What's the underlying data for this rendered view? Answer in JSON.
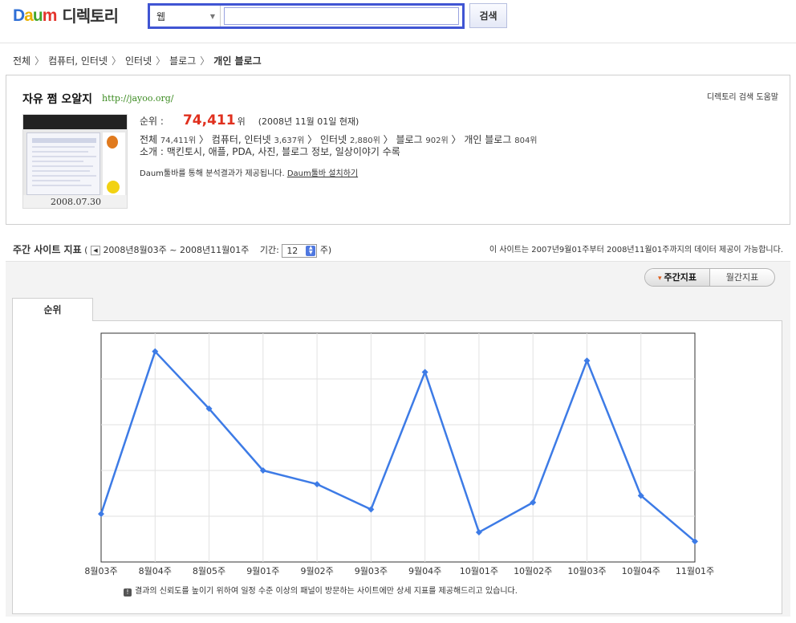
{
  "header": {
    "logo_letters": [
      {
        "ch": "D",
        "color": "#2f6fd6"
      },
      {
        "ch": "a",
        "color": "#e8b100"
      },
      {
        "ch": "u",
        "color": "#40a62d"
      },
      {
        "ch": "m",
        "color": "#e4342c"
      }
    ],
    "title": "디렉토리",
    "search_scope": "웹",
    "search_value": "",
    "search_button": "검색",
    "search_border_color": "#4055d3"
  },
  "breadcrumb": [
    {
      "label": "전체",
      "current": false
    },
    {
      "label": "컴퓨터, 인터넷",
      "current": false
    },
    {
      "label": "인터넷",
      "current": false
    },
    {
      "label": "블로그",
      "current": false
    },
    {
      "label": "개인 블로그",
      "current": true
    }
  ],
  "breadcrumb_separator": "〉",
  "site": {
    "name": "자유 쩜 오알지",
    "url": "http://jayoo.org/",
    "help_link": "디렉토리 검색 도움말",
    "thumbnail_date": "2008.07.30",
    "rank_label": "순위 :",
    "rank_value": "74,411",
    "rank_unit": "위",
    "rank_color": "#e0301e",
    "rank_date": "(2008년 11월 01일 현재)",
    "category_ranks": [
      {
        "name": "전체",
        "rank": "74,411위"
      },
      {
        "name": "컴퓨터, 인터넷",
        "rank": "3,637위"
      },
      {
        "name": "인터넷",
        "rank": "2,880위"
      },
      {
        "name": "블로그",
        "rank": "902위"
      },
      {
        "name": "개인 블로그",
        "rank": "804위"
      }
    ],
    "intro_label": "소개 :",
    "intro_text": "맥킨토시, 애플, PDA, 사진, 블로그 정보, 일상이야기 수록",
    "toolbar_note": "Daum툴바를 통해 분석결과가 제공됩니다.",
    "toolbar_link": "Daum툴바 설치하기"
  },
  "stats": {
    "title": "주간 사이트 지표",
    "range": "2008년8월03주 ~ 2008년11월01주",
    "period_label": "기간:",
    "period_value": "12",
    "period_unit": "주)",
    "availability_note": "이 사이트는 2007년9월01주부터 2008년11월01주까지의 데이터 제공이 가능합니다.",
    "toggle": [
      {
        "label": "주간지표",
        "active": true
      },
      {
        "label": "월간지표",
        "active": false
      }
    ],
    "tab_label": "순위",
    "notice": "결과의 신뢰도를 높이기 위하여 일정 수준 이상의 패널이 방문하는 사이트에만 상세 지표를 제공해드리고 있습니다."
  },
  "chart_data": {
    "type": "line",
    "title": "",
    "xlabel": "",
    "ylabel": "",
    "categories": [
      "8월03주",
      "8월04주",
      "8월05주",
      "9월01주",
      "9월02주",
      "9월03주",
      "9월04주",
      "10월01주",
      "10월02주",
      "10월03주",
      "10월04주",
      "11월01주"
    ],
    "series": [
      {
        "values": [
          0.21,
          0.92,
          0.67,
          0.4,
          0.34,
          0.23,
          0.83,
          0.13,
          0.26,
          0.88,
          0.29,
          0.09
        ]
      }
    ],
    "value_unit_note": "rank level as fraction of plot height; no y-axis tick labels shown",
    "ylim": [
      0,
      1
    ],
    "grid": true,
    "line_color": "#3d7be6"
  }
}
